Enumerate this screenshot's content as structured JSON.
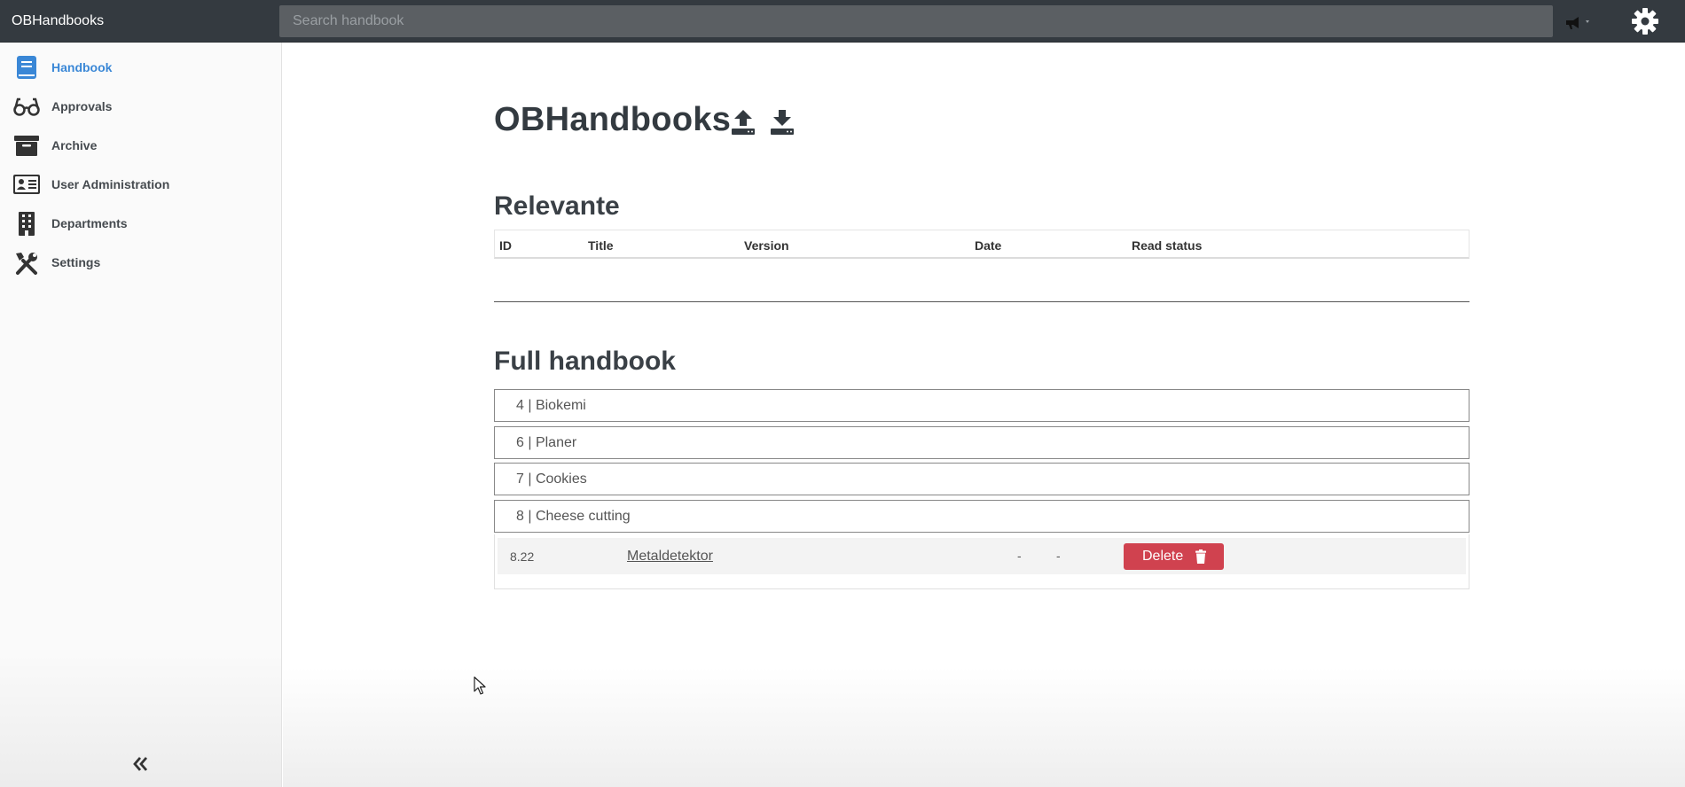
{
  "app": {
    "title": "OBHandbooks"
  },
  "topbar": {
    "search_placeholder": "Search handbook",
    "icons": [
      "megaphone-icon",
      "gear-icon"
    ]
  },
  "sidebar": {
    "items": [
      {
        "label": "Handbook",
        "icon": "book-icon",
        "active": true
      },
      {
        "label": "Approvals",
        "icon": "glasses-icon",
        "active": false
      },
      {
        "label": "Archive",
        "icon": "archive-box-icon",
        "active": false
      },
      {
        "label": "User Administration",
        "icon": "id-card-icon",
        "active": false
      },
      {
        "label": "Departments",
        "icon": "building-icon",
        "active": false
      },
      {
        "label": "Settings",
        "icon": "tools-icon",
        "active": false
      }
    ],
    "collapse_icon": "double-chevron-left-icon"
  },
  "main": {
    "title": "OBHandbooks",
    "relevant": {
      "heading": "Relevante",
      "columns": [
        "ID",
        "Title",
        "Version",
        "Date",
        "Read status"
      ]
    },
    "full": {
      "heading": "Full handbook",
      "groups": [
        {
          "label": "4 | Biokemi"
        },
        {
          "label": "6 | Planer"
        },
        {
          "label": "7 | Cookies"
        },
        {
          "label": "8 | Cheese cutting"
        }
      ],
      "items": [
        {
          "id": "8.22",
          "title": "Metaldetektor",
          "version": "-",
          "date": "-",
          "action": "Delete"
        }
      ]
    }
  },
  "colors": {
    "topbar": "#343a40",
    "accent": "#3a87d6",
    "danger": "#d0424f"
  }
}
